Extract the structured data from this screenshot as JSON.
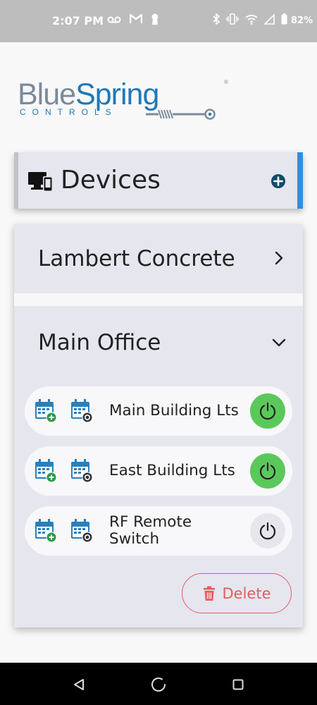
{
  "status_bar": {
    "time": "2:07 PM",
    "battery": "82%",
    "icons_left": [
      "voicemail-icon",
      "gmail-icon",
      "keyhole-icon"
    ],
    "icons_right": [
      "bluetooth-icon",
      "vibrate-icon",
      "wifi-icon",
      "signal-icon",
      "battery-icon"
    ]
  },
  "logo": {
    "name_part1": "Blue",
    "name_part2": "Spring",
    "subtitle": "CONTROLS",
    "reg": "®"
  },
  "devices_section": {
    "title": "Devices",
    "icon": "devices-icon",
    "add_icon": "plus-circle-icon"
  },
  "groups": [
    {
      "name": "Lambert Concrete",
      "expanded": false,
      "chevron": "chevron-right-icon"
    },
    {
      "name": "Main Office",
      "expanded": true,
      "chevron": "chevron-down-icon",
      "devices": [
        {
          "name": "Main Building Lts",
          "power_on": true
        },
        {
          "name": "East Building Lts",
          "power_on": true
        },
        {
          "name": "RF Remote Switch",
          "name_line1": "RF Remote",
          "name_line2": "Switch",
          "power_on": false
        }
      ],
      "delete_label": "Delete"
    }
  ],
  "colors": {
    "accent_blue": "#2f8fe3",
    "power_on_green": "#5bc85b",
    "delete_red": "#e35d5d",
    "brand_blue": "#1f79b6"
  }
}
